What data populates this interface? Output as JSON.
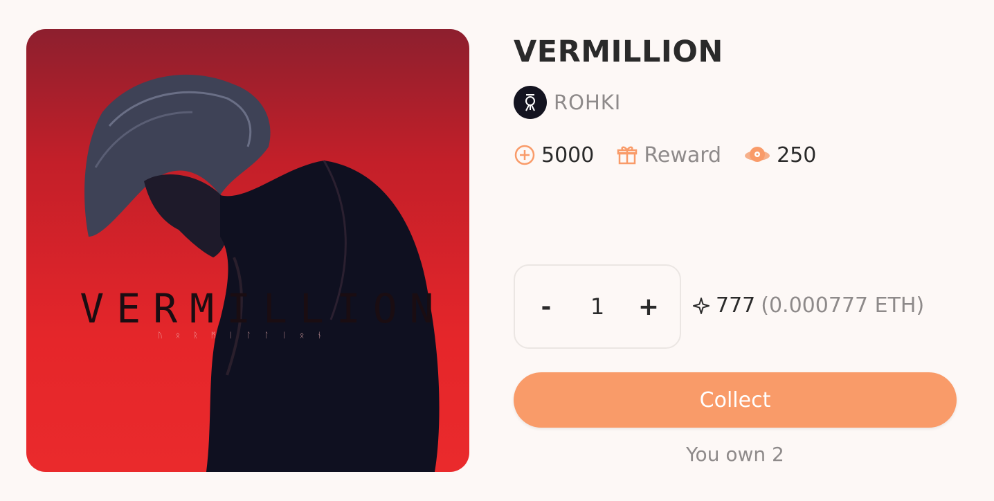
{
  "item": {
    "title": "VERMILLION",
    "artist": "ROHKI",
    "artwork": {
      "title_text": "VERMILLION"
    }
  },
  "stats": {
    "points": "5000",
    "reward_label": "Reward",
    "plays": "250"
  },
  "purchase": {
    "decrement_label": "-",
    "quantity": "1",
    "increment_label": "+",
    "price": "777",
    "price_eth": "(0.000777 ETH)",
    "collect_label": "Collect",
    "owned_text": "You own 2"
  },
  "colors": {
    "accent": "#f99b69",
    "text": "#2a2a2a",
    "muted": "#8e8a8a",
    "background": "#fdf8f6"
  },
  "icons": {
    "points": "plus-circle-icon",
    "reward": "gift-icon",
    "plays": "planet-disc-icon",
    "price": "sparkle-icon"
  }
}
